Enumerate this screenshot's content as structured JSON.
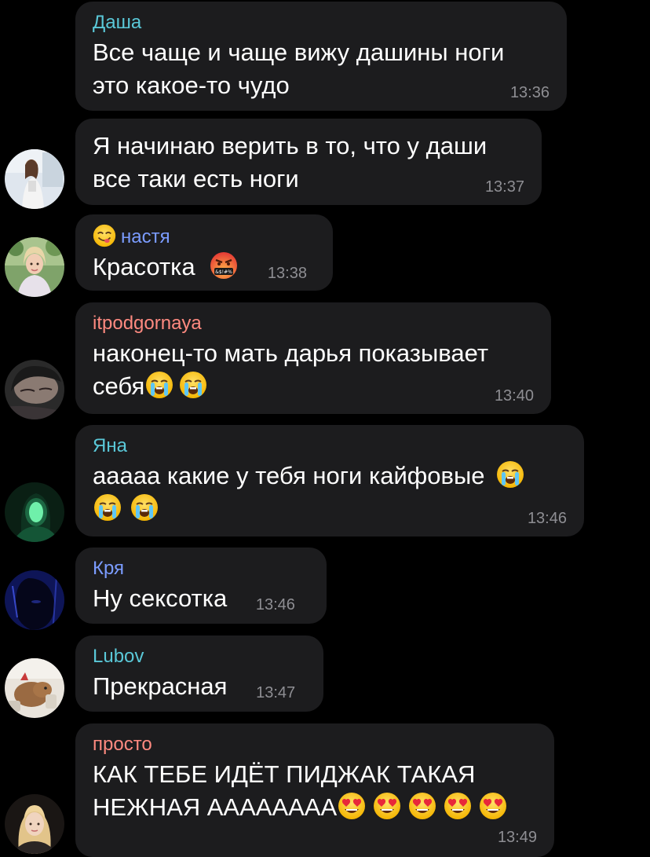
{
  "messages": [
    {
      "sender": "Даша",
      "sender_color": "#5ac8d8",
      "lines": [
        "Все чаще и чаще вижу дашины ноги",
        "это какое-то чудо"
      ],
      "time": "13:36",
      "avatar": null
    },
    {
      "sender": "",
      "lines": [
        "Я начинаю верить в то, что у даши",
        "все таки есть ноги"
      ],
      "time": "13:37",
      "avatar": "girl-light-room-avatar"
    },
    {
      "sender": "настя",
      "sender_emoji": "face-savoring-food-emoji",
      "sender_color": "#7b9cff",
      "lines": [
        "Красотка"
      ],
      "text_emoji": "face-with-symbols-on-mouth-emoji",
      "time": "13:38",
      "avatar": "blonde-girl-avatar"
    },
    {
      "sender": "itpodgornaya",
      "sender_color": "#ff8a80",
      "lines": [
        "наконец-то мать дарья показывает",
        "себя"
      ],
      "text_emoji": "loudly-crying-face-emoji",
      "time": "13:40",
      "avatar": "dark-face-avatar"
    },
    {
      "sender": "Яна",
      "sender_color": "#5ac8d8",
      "lines": [
        "ааааа какие у тебя ноги кайфовые"
      ],
      "text_emoji": "loudly-crying-face-emoji",
      "time": "13:46",
      "avatar": "green-light-avatar"
    },
    {
      "sender": "Кря",
      "sender_color": "#7b9cff",
      "lines": [
        "Ну сексотка"
      ],
      "time": "13:46",
      "avatar": "blue-dark-avatar"
    },
    {
      "sender": "Lubov",
      "sender_color": "#5ac8d8",
      "lines": [
        "Прекрасная"
      ],
      "time": "13:47",
      "avatar": "capybara-avatar"
    },
    {
      "sender": "просто",
      "sender_color": "#ff8a80",
      "lines": [
        "КАК ТЕБЕ ИДЁТ ПИДЖАК ТАКАЯ",
        "НЕЖНАЯ АААААААА"
      ],
      "text_emoji": "smiling-face-with-heart-eyes-emoji",
      "time": "13:49",
      "avatar": "blonde-portrait-avatar"
    }
  ]
}
